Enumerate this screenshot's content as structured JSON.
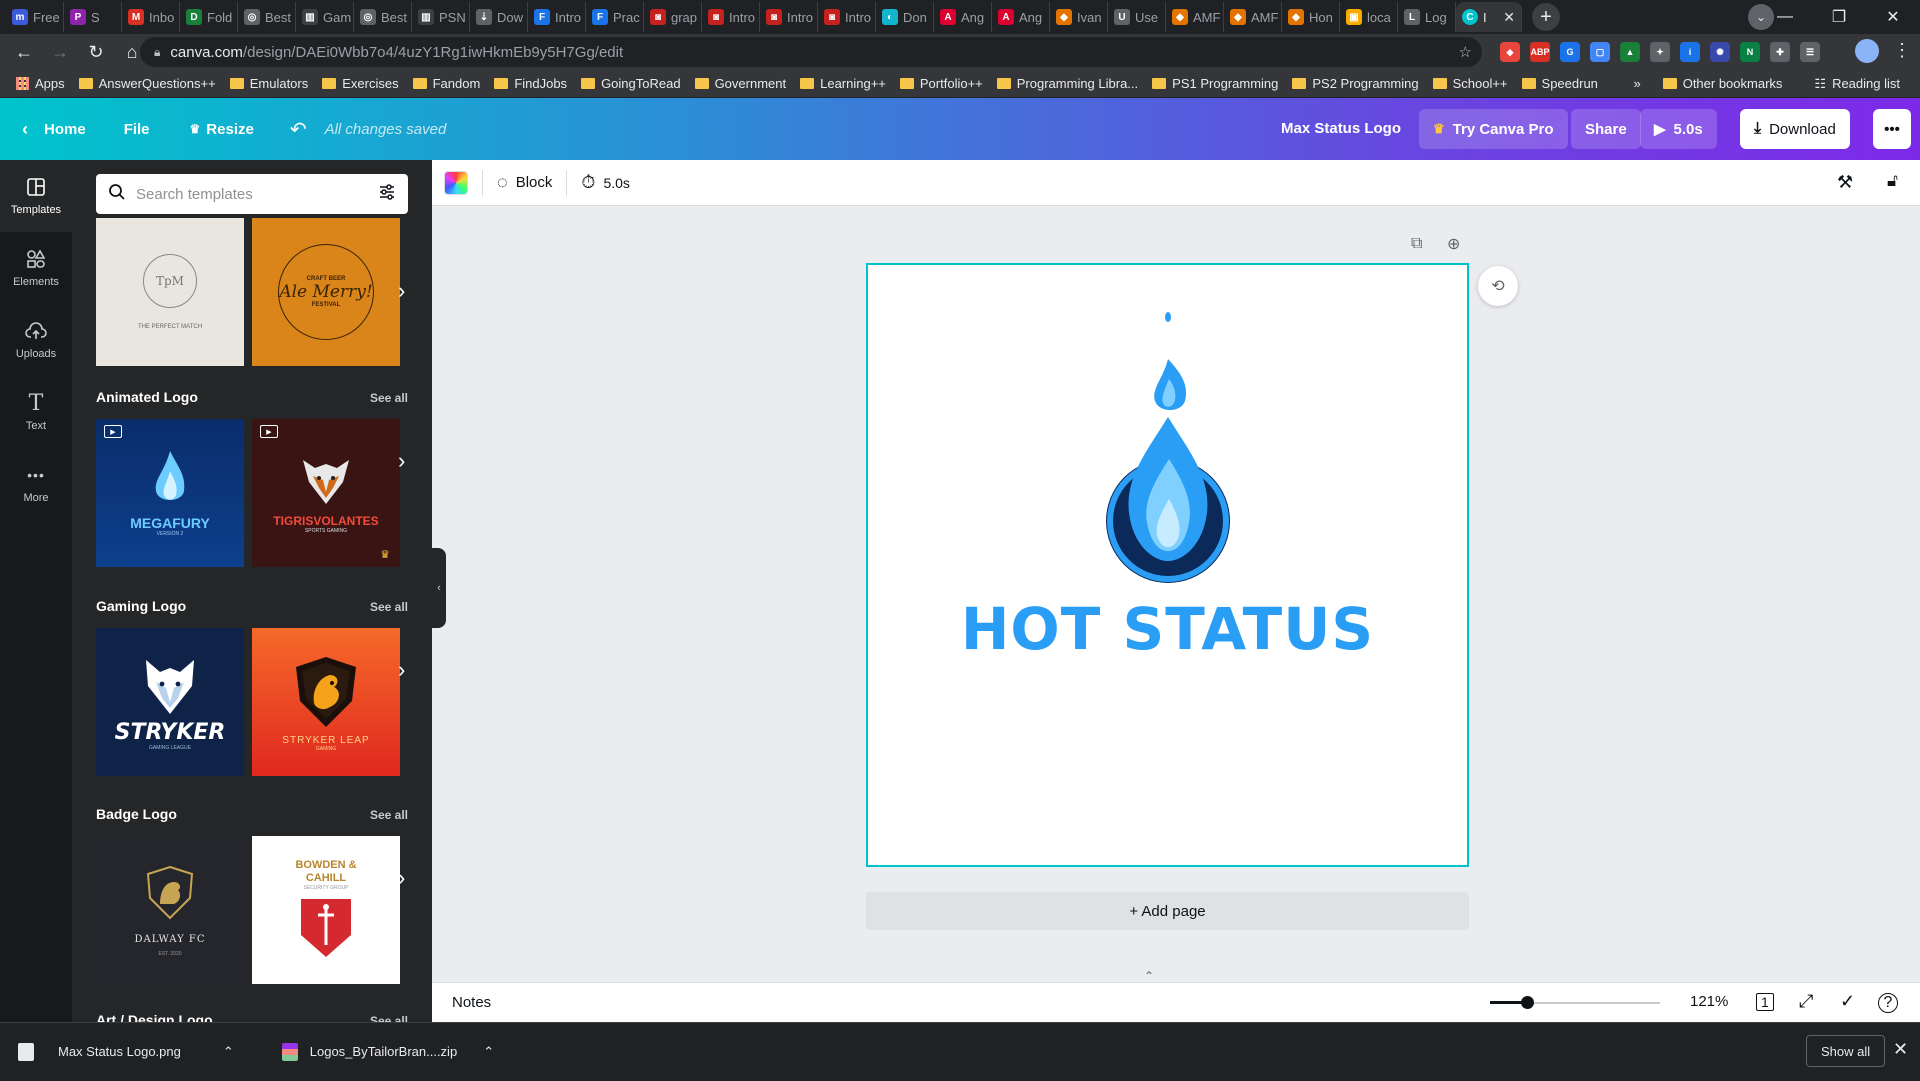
{
  "browser": {
    "tabs": [
      {
        "label": "Free",
        "color": "#3b5bdb",
        "glyph": "m"
      },
      {
        "label": "S",
        "color": "#8e24aa",
        "glyph": "P"
      },
      {
        "label": "Inbo",
        "color": "#d93025",
        "glyph": "M"
      },
      {
        "label": "Fold",
        "color": "#188038",
        "glyph": "D"
      },
      {
        "label": "Best",
        "color": "#5f6368",
        "glyph": "◎"
      },
      {
        "label": "Gam",
        "color": "#3c4043",
        "glyph": "▥"
      },
      {
        "label": "Best",
        "color": "#5f6368",
        "glyph": "◎"
      },
      {
        "label": "PSN",
        "color": "#3c4043",
        "glyph": "▥"
      },
      {
        "label": "Dow",
        "color": "#5f6368",
        "glyph": "⇣"
      },
      {
        "label": "Intro",
        "color": "#1a73e8",
        "glyph": "F"
      },
      {
        "label": "Prac",
        "color": "#1a73e8",
        "glyph": "F"
      },
      {
        "label": "grap",
        "color": "#c5221f",
        "glyph": "◙"
      },
      {
        "label": "Intro",
        "color": "#c5221f",
        "glyph": "◙"
      },
      {
        "label": "Intro",
        "color": "#c5221f",
        "glyph": "◙"
      },
      {
        "label": "Intro",
        "color": "#c5221f",
        "glyph": "◙"
      },
      {
        "label": "Don",
        "color": "#12b5cb",
        "glyph": "◐"
      },
      {
        "label": "Ang",
        "color": "#dd0031",
        "glyph": "A"
      },
      {
        "label": "Ang",
        "color": "#dd0031",
        "glyph": "A"
      },
      {
        "label": "Ivan",
        "color": "#e37400",
        "glyph": "◆"
      },
      {
        "label": "Use",
        "color": "#5f6368",
        "glyph": "U"
      },
      {
        "label": "AMF",
        "color": "#e37400",
        "glyph": "◆"
      },
      {
        "label": "AMF",
        "color": "#e37400",
        "glyph": "◆"
      },
      {
        "label": "Hon",
        "color": "#e37400",
        "glyph": "◆"
      },
      {
        "label": "loca",
        "color": "#f9ab00",
        "glyph": "▣"
      },
      {
        "label": "Log",
        "color": "#5f6368",
        "glyph": "L"
      }
    ],
    "active_tab": {
      "label": "I",
      "color": "#00c4cc",
      "glyph": "C"
    },
    "url_host": "canva.com",
    "url_path": "/design/DAEi0Wbb7o4/4uzY1Rg1iwHkmEb9y5H7Gg/edit",
    "bookmarks": [
      "Apps",
      "AnswerQuestions++",
      "Emulators",
      "Exercises",
      "Fandom",
      "FindJobs",
      "GoingToRead",
      "Government",
      "Learning++",
      "Portfolio++",
      "Programming Libra...",
      "PS1 Programming",
      "PS2 Programming",
      "School++",
      "Speedrun"
    ],
    "bookmarks_overflow": "»",
    "other_bookmarks": "Other bookmarks",
    "reading_list": "Reading list"
  },
  "canva": {
    "home": "Home",
    "file": "File",
    "resize": "Resize",
    "saved_status": "All changes saved",
    "design_title": "Max Status Logo",
    "try_pro": "Try Canva Pro",
    "share": "Share",
    "play_duration": "5.0s",
    "download": "Download",
    "rail": [
      "Templates",
      "Elements",
      "Uploads",
      "Text",
      "More"
    ],
    "search_placeholder": "Search templates",
    "sections": [
      {
        "title": "Animated Logo",
        "see_all": "See all"
      },
      {
        "title": "Gaming Logo",
        "see_all": "See all"
      },
      {
        "title": "Badge Logo",
        "see_all": "See all"
      },
      {
        "title": "Art / Design Logo",
        "see_all": "See all"
      }
    ],
    "thumbs": {
      "perfect_match": "THE PERFECT MATCH",
      "perfect_match_mono": "TpM",
      "ale_merry": "Ale Merry!",
      "craft_beer": "CRAFT BEER",
      "festival": "FESTIVAL",
      "megafury": "MEGAFURY",
      "megafury_sub": "VERSION 2",
      "tigris": "TIGRISVOLANTES",
      "tigris_sub": "SPORTS GAMING",
      "stryker": "STRYKER",
      "stryker_sub": "GAMING LEAGUE",
      "stryker_leap": "STRYKER LEAP",
      "stryker_leap_sub": "GAMING",
      "dalway": "DALWAY FC",
      "dalway_sub": "EST. 2020",
      "bowden": "BOWDEN & CAHILL",
      "bowden_sub": "SECURITY GROUP"
    },
    "toolbar": {
      "effect": "Block",
      "timing": "5.0s"
    },
    "canvas_text": "HOT STATUS",
    "add_page": "+ Add page",
    "notes": "Notes",
    "zoom": "121%",
    "zoom_level": 0.22,
    "page_count": "1"
  },
  "downloads": [
    {
      "name": "Max Status Logo.png"
    },
    {
      "name": "Logos_ByTailorBran....zip"
    }
  ],
  "show_all": "Show all",
  "colors": {
    "accent": "#00c4cc",
    "logo_blue": "#2a9df4",
    "navy": "#0b2a5a"
  }
}
